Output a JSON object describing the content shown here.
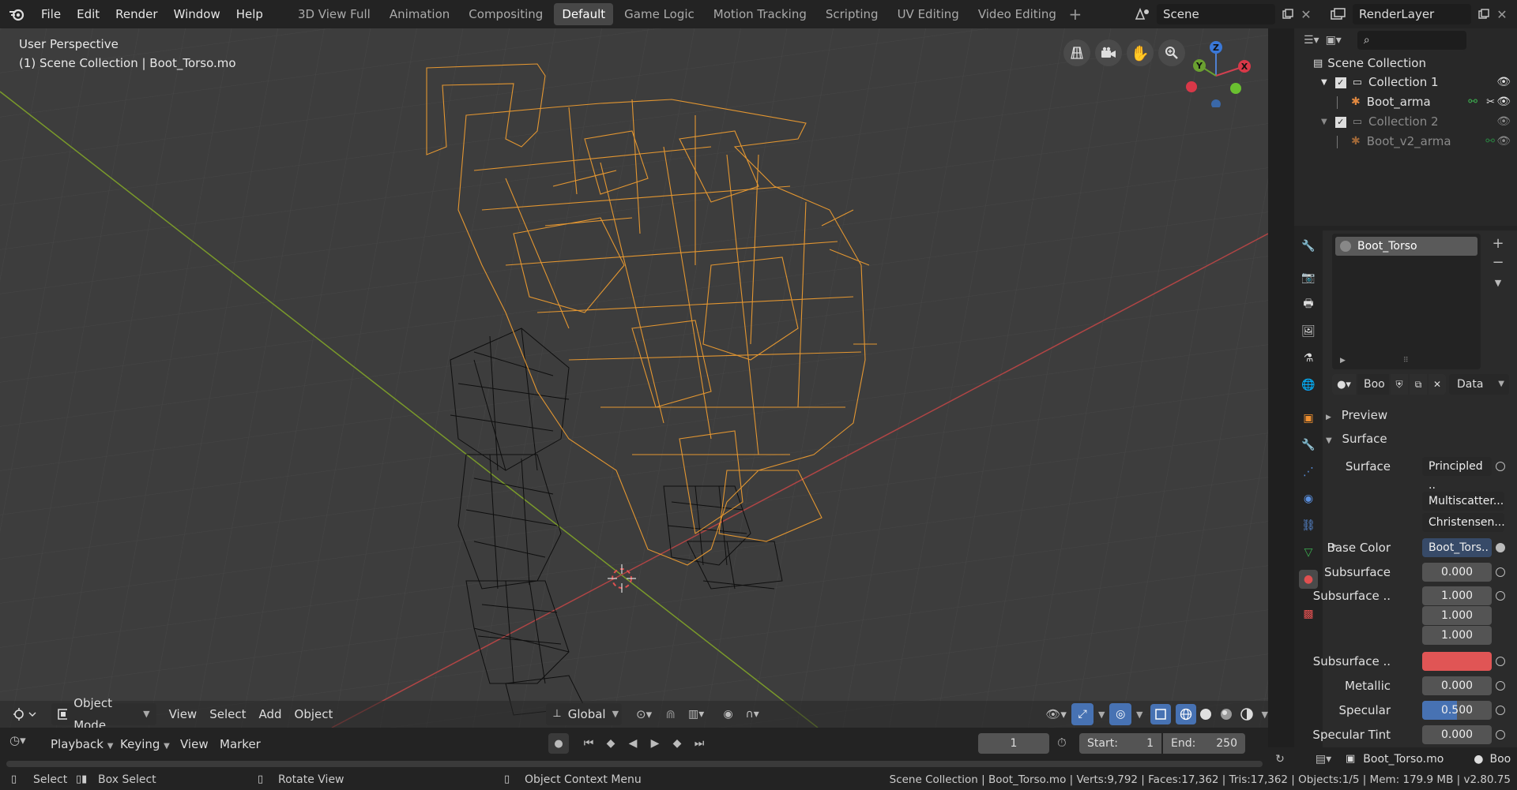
{
  "menu": {
    "file": "File",
    "edit": "Edit",
    "render": "Render",
    "window": "Window",
    "help": "Help"
  },
  "workspaces": [
    "3D View Full",
    "Animation",
    "Compositing",
    "Default",
    "Game Logic",
    "Motion Tracking",
    "Scripting",
    "UV Editing",
    "Video Editing"
  ],
  "active_workspace": "Default",
  "scene": "Scene",
  "render_layer": "RenderLayer",
  "viewport": {
    "perspective": "User Perspective",
    "collection_info": "(1) Scene Collection | Boot_Torso.mo"
  },
  "gizmo": {
    "z": "Z",
    "y": "Y",
    "x": "X"
  },
  "viewport_header": {
    "mode": "Object Mode",
    "view": "View",
    "select": "Select",
    "add": "Add",
    "object": "Object",
    "orientation": "Global"
  },
  "outliner": {
    "root": "Scene Collection",
    "rows": [
      {
        "label": "Collection 1"
      },
      {
        "label": "Boot_arma"
      },
      {
        "label": "Collection 2"
      },
      {
        "label": "Boot_v2_arma"
      }
    ]
  },
  "material": {
    "slot": "Boot_Torso",
    "name": "Boo",
    "link": "Data",
    "preview": "Preview",
    "surface_panel": "Surface",
    "surface_label": "Surface",
    "surface_value": "Principled ..",
    "dist1": "Multiscatter...",
    "dist2": "Christensen...",
    "base_color_label": "Base Color",
    "base_color_value": "Boot_Tors..",
    "subsurface_label": "Subsurface",
    "subsurface_value": "0.000",
    "subsurface_radius_label": "Subsurface ..",
    "radius": [
      "1.000",
      "1.000",
      "1.000"
    ],
    "subsurface_color_label": "Subsurface ..",
    "subsurface_color": "#e05555",
    "metallic_label": "Metallic",
    "metallic_value": "0.000",
    "specular_label": "Specular",
    "specular_value": "0.500",
    "specular_fraction": 0.5,
    "specular_tint_label": "Specular Tint",
    "specular_tint_value": "0.000"
  },
  "timeline": {
    "playback": "Playback",
    "keying": "Keying",
    "view": "View",
    "marker": "Marker",
    "frame": "1",
    "start_label": "Start:",
    "start": "1",
    "end_label": "End:",
    "end": "250"
  },
  "props_footer": {
    "object": "Boot_Torso.mo",
    "next": "Boo"
  },
  "status": {
    "select": "Select",
    "box_select": "Box Select",
    "rotate_view": "Rotate View",
    "context_menu": "Object Context Menu",
    "info": "Scene Collection | Boot_Torso.mo | Verts:9,792 | Faces:17,362 | Tris:17,362 | Objects:1/5 | Mem: 179.9 MB | v2.80.75"
  },
  "colors": {
    "accent": "#4772b3",
    "selection": "#f5a030",
    "wire": "#0a0a0a"
  }
}
